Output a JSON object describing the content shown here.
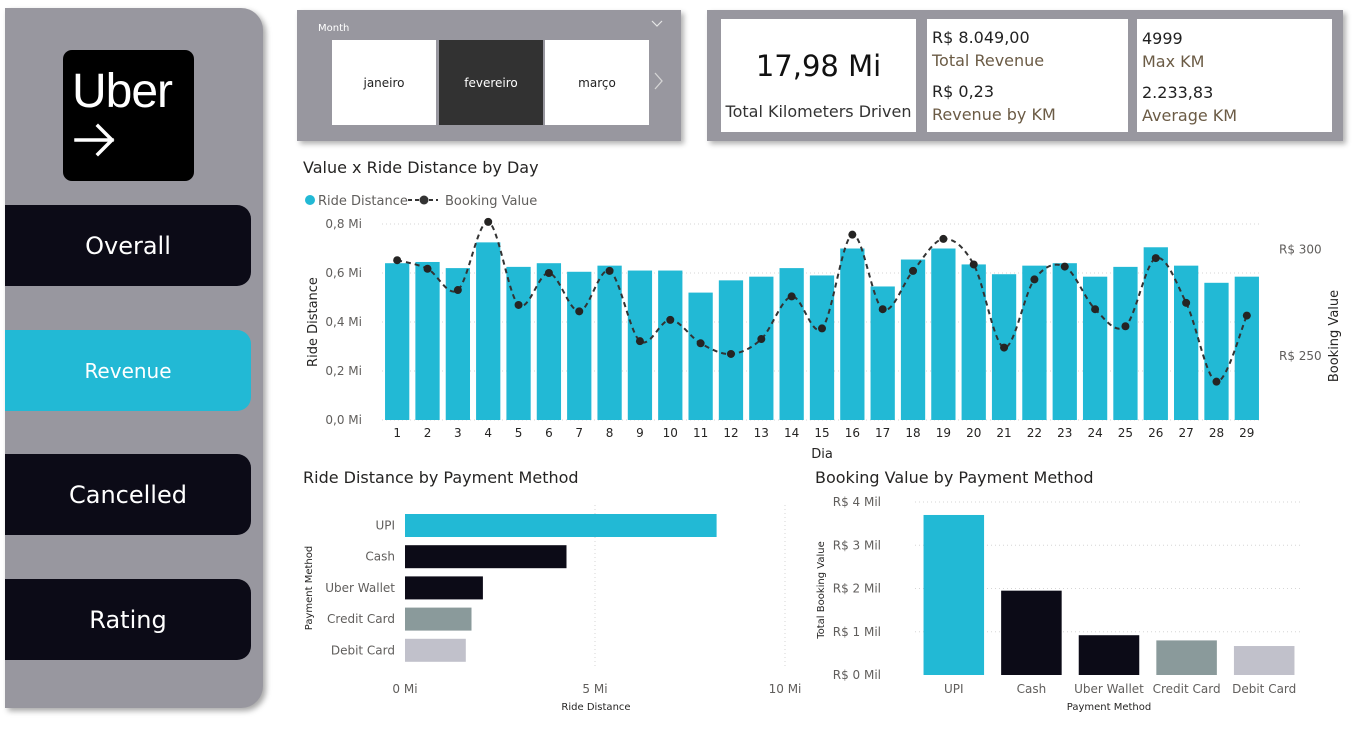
{
  "logo": {
    "text": "Uber"
  },
  "nav": [
    {
      "label": "Overall",
      "active": false
    },
    {
      "label": "Revenue",
      "active": true
    },
    {
      "label": "Cancelled",
      "active": false
    },
    {
      "label": "Rating",
      "active": false
    }
  ],
  "slicer": {
    "title": "Month",
    "months": [
      {
        "label": "janeiro",
        "selected": false
      },
      {
        "label": "fevereiro",
        "selected": true
      },
      {
        "label": "março",
        "selected": false
      }
    ]
  },
  "kpis": {
    "total_km": {
      "value": "17,98 Mi",
      "label": "Total Kilometers Driven"
    },
    "total_revenue": {
      "value": "R$ 8.049,00",
      "label": "Total Revenue"
    },
    "revenue_by_km": {
      "value": "R$ 0,23",
      "label": "Revenue by KM"
    },
    "max_km": {
      "value": "4999",
      "label": "Max KM"
    },
    "avg_km": {
      "value": "2.233,83",
      "label": "Average KM"
    }
  },
  "colors": {
    "accent": "#22b9d5",
    "dark": "#0c0b17",
    "gray": "#8a9a9b",
    "light_gray": "#c1c1cb",
    "panel": "#98979f"
  },
  "chart_data": [
    {
      "type": "bar",
      "title": "Value x Ride Distance by Day",
      "legend": [
        "Ride Distance",
        "Booking Value"
      ],
      "legend_position": "top-left",
      "xlabel": "Dia",
      "ylabel": "Ride Distance",
      "y2label": "Booking Value",
      "categories": [
        1,
        2,
        3,
        4,
        5,
        6,
        7,
        8,
        9,
        10,
        11,
        12,
        13,
        14,
        15,
        16,
        17,
        18,
        19,
        20,
        21,
        22,
        23,
        24,
        25,
        26,
        27,
        28,
        29
      ],
      "ylim": [
        0,
        0.8
      ],
      "y_ticks": [
        "0,0 Mi",
        "0,2 Mi",
        "0,4 Mi",
        "0,6 Mi",
        "0,8 Mi"
      ],
      "y2lim": [
        220,
        312
      ],
      "y2_ticks": [
        "R$ 250",
        "R$ 300"
      ],
      "series": [
        {
          "name": "Ride Distance",
          "kind": "bar",
          "color": "#22b9d5",
          "values": [
            0.64,
            0.645,
            0.62,
            0.725,
            0.625,
            0.64,
            0.605,
            0.63,
            0.61,
            0.61,
            0.52,
            0.57,
            0.585,
            0.62,
            0.59,
            0.7,
            0.545,
            0.655,
            0.7,
            0.635,
            0.595,
            0.63,
            0.64,
            0.585,
            0.625,
            0.705,
            0.63,
            0.56,
            0.585
          ]
        },
        {
          "name": "Booking Value",
          "kind": "line",
          "color": "#333333",
          "values": [
            295,
            291,
            281,
            313,
            274,
            289,
            271,
            290,
            257,
            267,
            256,
            251,
            258,
            278,
            263,
            307,
            272,
            290,
            305,
            293,
            254,
            286,
            292,
            272,
            264,
            296,
            275,
            238,
            269
          ]
        }
      ],
      "grid": true
    },
    {
      "type": "bar",
      "orientation": "horizontal",
      "title": "Ride Distance by Payment Method",
      "xlabel": "Ride Distance",
      "ylabel": "Payment Method",
      "categories": [
        "UPI",
        "Cash",
        "Uber Wallet",
        "Credit Card",
        "Debit Card"
      ],
      "values": [
        8.2,
        4.25,
        2.05,
        1.75,
        1.6
      ],
      "colors": [
        "#22b9d5",
        "#0c0b17",
        "#0c0b17",
        "#8a9a9b",
        "#c1c1cb"
      ],
      "xlim": [
        0,
        10
      ],
      "x_ticks": [
        "0 Mi",
        "5 Mi",
        "10 Mi"
      ]
    },
    {
      "type": "bar",
      "title": "Booking Value by Payment Method",
      "xlabel": "Payment Method",
      "ylabel": "Total Booking Value",
      "categories": [
        "UPI",
        "Cash",
        "Uber Wallet",
        "Credit Card",
        "Debit Card"
      ],
      "values": [
        3.7,
        1.95,
        0.92,
        0.8,
        0.67
      ],
      "colors": [
        "#22b9d5",
        "#0c0b17",
        "#0c0b17",
        "#8a9a9b",
        "#c1c1cb"
      ],
      "ylim": [
        0,
        4
      ],
      "y_ticks": [
        "R$ 0 Mil",
        "R$ 1 Mil",
        "R$ 2 Mil",
        "R$ 3 Mil",
        "R$ 4 Mil"
      ]
    }
  ]
}
